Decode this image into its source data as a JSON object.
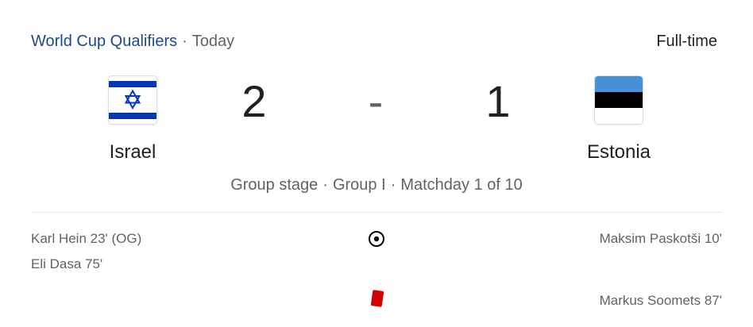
{
  "header": {
    "competition": "World Cup Qualifiers",
    "separator": "·",
    "date": "Today",
    "status": "Full-time"
  },
  "home": {
    "name": "Israel",
    "score": "2",
    "flag_icon": "israel-flag-icon"
  },
  "away": {
    "name": "Estonia",
    "score": "1",
    "flag_icon": "estonia-flag-icon"
  },
  "score_separator": "-",
  "stage": {
    "round": "Group stage",
    "group": "Group I",
    "matchday": "Matchday 1 of 10",
    "separator": "·"
  },
  "events": {
    "goals": {
      "icon": "soccer-ball-icon",
      "home": [
        "Karl Hein 23' (OG)",
        "Eli Dasa 75'"
      ],
      "away": [
        "Maksim Paskotši 10'"
      ]
    },
    "red_cards": {
      "icon": "red-card-icon",
      "home": [],
      "away": [
        "Markus Soomets 87'"
      ]
    }
  },
  "colors": {
    "link": "#1a4a8b",
    "red_card": "#d50000",
    "israel_blue": "#0038b8",
    "estonia_blue": "#4891d9"
  }
}
